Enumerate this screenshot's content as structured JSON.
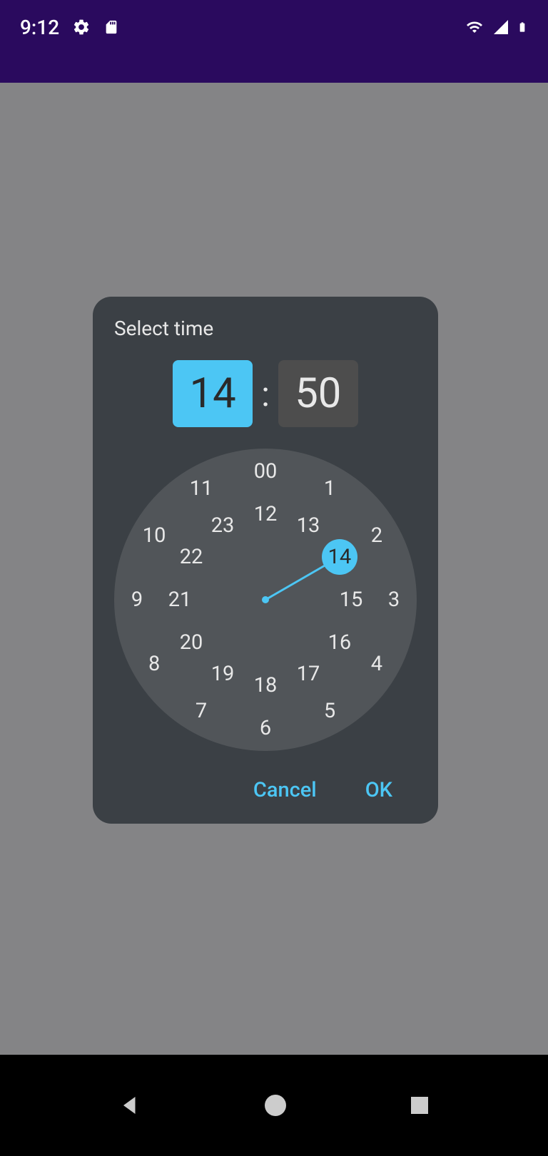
{
  "status": {
    "time": "9:12"
  },
  "dialog": {
    "title": "Select time",
    "hour": "14",
    "minute": "50",
    "colon": ":"
  },
  "clock": {
    "selected_value": "14",
    "outer": [
      "00",
      "1",
      "2",
      "3",
      "4",
      "5",
      "6",
      "7",
      "8",
      "9",
      "10",
      "11"
    ],
    "inner": [
      "12",
      "13",
      "14",
      "15",
      "16",
      "17",
      "18",
      "19",
      "20",
      "21",
      "22",
      "23"
    ]
  },
  "actions": {
    "cancel": "Cancel",
    "ok": "OK"
  },
  "colors": {
    "accent": "#4cc6f4",
    "dialog_bg": "#3b4045",
    "clock_bg": "#515559"
  }
}
